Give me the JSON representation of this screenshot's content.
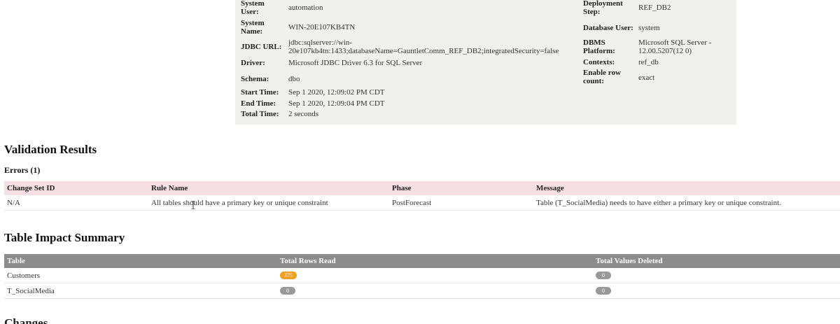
{
  "info": {
    "left": [
      {
        "label": "System User:",
        "value": "automation"
      },
      {
        "label": "System Name:",
        "value": "WIN-20E107KB4TN"
      },
      {
        "label": "JDBC URL:",
        "value": "jdbc:sqlserver://win-20e107kb4tn:1433;databaseName=GauntletComm_REF_DB2;integratedSecurity=false"
      },
      {
        "label": "Driver:",
        "value": "Microsoft JDBC Driver 6.3 for SQL Server"
      },
      {
        "label": "Schema:",
        "value": "dbo"
      },
      {
        "label": "Start Time:",
        "value": "Sep 1 2020, 12:09:02 PM CDT"
      },
      {
        "label": "End Time:",
        "value": "Sep 1 2020, 12:09:04 PM CDT"
      },
      {
        "label": "Total Time:",
        "value": "2 seconds"
      }
    ],
    "right": [
      {
        "label": "Deployment Step:",
        "value": "REF_DB2"
      },
      {
        "label": "Database User:",
        "value": "system"
      },
      {
        "label": "DBMS Platform:",
        "value": "Microsoft SQL Server - 12.00.5207(12 0)"
      },
      {
        "label": "Contexts:",
        "value": "ref_db"
      },
      {
        "label": "Enable row count:",
        "value": "exact"
      }
    ]
  },
  "validation": {
    "title": "Validation Results",
    "errors_label": "Errors (1)",
    "headers": [
      "Change Set ID",
      "Rule Name",
      "Phase",
      "Message"
    ],
    "rows": [
      [
        "N/A",
        "All tables should have a primary key or unique constraint",
        "PostForecast",
        "Table (T_SocialMedia) needs to have either a primary key or unique constraint."
      ]
    ]
  },
  "impact": {
    "title": "Table Impact Summary",
    "headers": [
      "Table",
      "Total Rows Read",
      "Total Values Deleted"
    ],
    "rows": [
      {
        "table": "Customers",
        "rows_read": "375",
        "deleted": "0"
      },
      {
        "table": "T_SocialMedia",
        "rows_read": "0",
        "deleted": "0"
      }
    ]
  },
  "next_section": "Changes",
  "colors": {
    "badge_orange": "#f0a020",
    "badge_gray": "#999999",
    "error_header": "#f6dfe3",
    "impact_header": "#8c8c8c"
  }
}
